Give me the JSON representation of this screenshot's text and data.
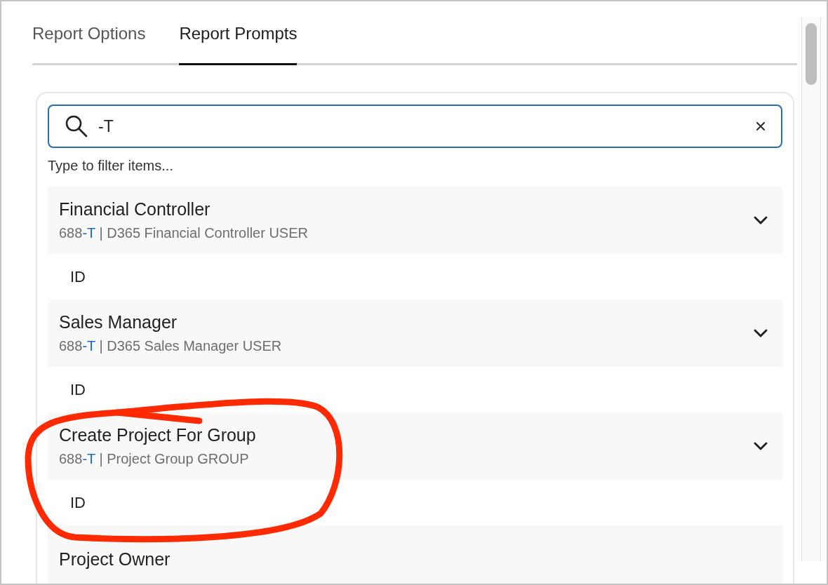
{
  "tabs": [
    {
      "label": "Report Options",
      "selected": false
    },
    {
      "label": "Report Prompts",
      "selected": true
    }
  ],
  "search": {
    "value": "-T",
    "hint": "Type to filter items..."
  },
  "items": [
    {
      "title": "Financial Controller",
      "code": "688",
      "match": "-T",
      "detail": "| D365 Financial Controller USER",
      "expanded": false,
      "field": "ID"
    },
    {
      "title": "Sales Manager",
      "code": "688",
      "match": "-T",
      "detail": "| D365 Sales Manager USER",
      "expanded": false,
      "field": "ID"
    },
    {
      "title": "Create Project For Group",
      "code": "688",
      "match": "-T",
      "detail": "| Project Group GROUP",
      "expanded": false,
      "field": "ID"
    },
    {
      "title": "Project Owner"
    }
  ],
  "annotation": {
    "kind": "freehand-loop"
  }
}
